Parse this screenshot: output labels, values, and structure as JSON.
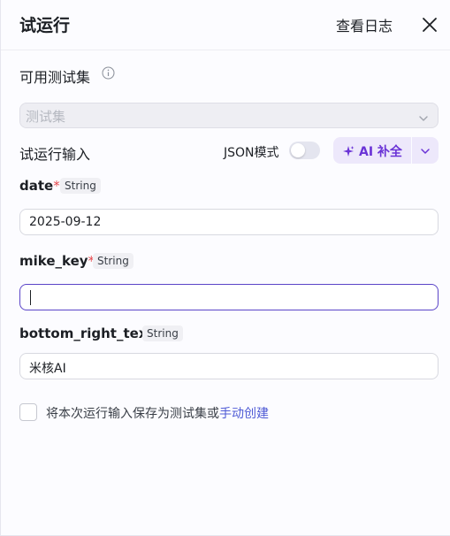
{
  "header": {
    "title": "试运行",
    "view_log": "查看日志"
  },
  "test_set": {
    "label": "可用测试集",
    "placeholder": "测试集"
  },
  "run_input": {
    "label": "试运行输入",
    "json_mode_label": "JSON模式",
    "json_mode_on": false,
    "ai_button_label": "AI 补全"
  },
  "fields": [
    {
      "name": "date",
      "required": true,
      "type": "String",
      "value": "2025-09-12"
    },
    {
      "name": "mike_key",
      "required": true,
      "type": "String",
      "value": ""
    },
    {
      "name": "bottom_right_text",
      "required": false,
      "type": "String",
      "value": "米核AI"
    }
  ],
  "save": {
    "text": "将本次运行输入保存为测试集或",
    "link": "手动创建"
  },
  "colors": {
    "accent": "#6a33d6",
    "link": "#4f5bd5",
    "required": "#e5484d",
    "focus_border": "#5b45c8"
  }
}
